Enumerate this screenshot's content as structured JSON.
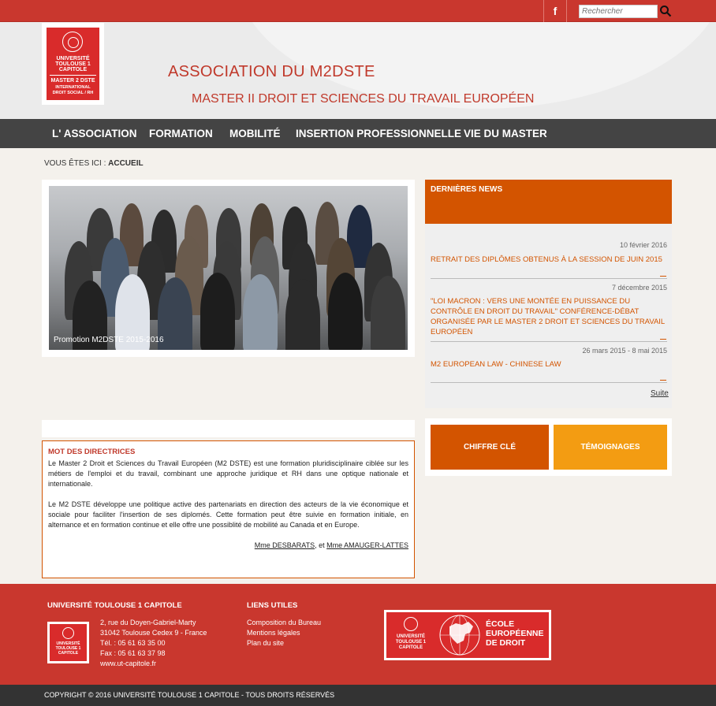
{
  "topbar": {
    "facebook_label": "f",
    "search_placeholder": "Rechercher"
  },
  "header": {
    "title": "ASSOCIATION DU M2DSTE",
    "subtitle": "MASTER II DROIT ET SCIENCES DU TRAVAIL EUROPÉEN",
    "logo_lines": [
      "UNIVERSITÉ",
      "TOULOUSE 1",
      "CAPITOLE",
      "MASTER 2 DSTE",
      "INTERNATIONAL",
      "DROIT SOCIAL / RH"
    ]
  },
  "nav": {
    "items": [
      "L' ASSOCIATION",
      "FORMATION",
      "MOBILITÉ",
      "INSERTION PROFESSIONNELLE",
      "VIE DU MASTER"
    ]
  },
  "breadcrumb": {
    "prefix": "VOUS ÊTES ICI :",
    "current": "ACCUEIL"
  },
  "slider": {
    "caption": "Promotion M2DSTE 2015-2016"
  },
  "news": {
    "heading": "DERNIÈRES NEWS",
    "items": [
      {
        "date": "10 février 2016",
        "title": "RETRAIT DES DIPLÔMES OBTENUS À LA SESSION DE JUIN 2015"
      },
      {
        "date": "7 décembre 2015",
        "title": "\"LOI MACRON : VERS UNE MONTÉE EN PUISSANCE DU CONTRÔLE EN DROIT DU TRAVAIL\" CONFÉRENCE-DÉBAT ORGANISÉE PAR LE MASTER 2 DROIT ET SCIENCES DU TRAVAIL EUROPÉEN"
      },
      {
        "date": "26 mars 2015 - 8 mai 2015",
        "title": "M2 EUROPEAN LAW - CHINESE LAW"
      }
    ],
    "more_label": "Suite"
  },
  "boxes": {
    "chiffre_label": "CHIFFRE CLÉ",
    "temoignages_label": "TÉMOIGNAGES",
    "chiffre_color": "#d35400",
    "temoignages_color": "#f39c12"
  },
  "mot": {
    "title": "MOT DES DIRECTRICES",
    "paragraph1": "Le Master 2  Droit et Sciences du Travail Européen (M2 DSTE) est une formation pluridisciplinaire ciblée sur les métiers de l'emploi et du travail, combinant une approche juridique et RH dans une optique nationale et internationale.",
    "paragraph2": "Le M2 DSTE développe une politique active des partenariats en direction des acteurs de la vie économique et sociale pour faciliter l'insertion de ses diplomés. Cette formation peut être suivie en formation initiale, en alternance et en formation continue et elle offre une possiblité de mobilité au Canada et en Europe.",
    "signature_name1": "Mme DESBARATS",
    "signature_sep": ", et ",
    "signature_name2": "Mme AMAUGER-LATTES"
  },
  "footer": {
    "col1_title": "UNIVERSITÉ TOULOUSE 1 CAPITOLE",
    "address": [
      "2, rue du Doyen-Gabriel-Marty",
      "31042 Toulouse Cedex 9 - France",
      "Tél. : 05 61 63 35 00",
      "Fax : 05 61 63 37 98",
      "www.ut-capitole.fr"
    ],
    "col2_title": "LIENS UTILES",
    "links": [
      "Composition du Bureau",
      "Mentions légales",
      "Plan du site"
    ],
    "ecole_lines": [
      "ÉCOLE",
      "EUROPÉENNE",
      "DE DROIT"
    ],
    "copyright": "COPYRIGHT © 2016 UNIVERSITÉ TOULOUSE 1 CAPITOLE - TOUS DROITS RÉSERVÉS"
  },
  "colors": {
    "brand_red": "#c9372e",
    "accent_orange": "#d35400",
    "nav_bg": "#444444"
  }
}
